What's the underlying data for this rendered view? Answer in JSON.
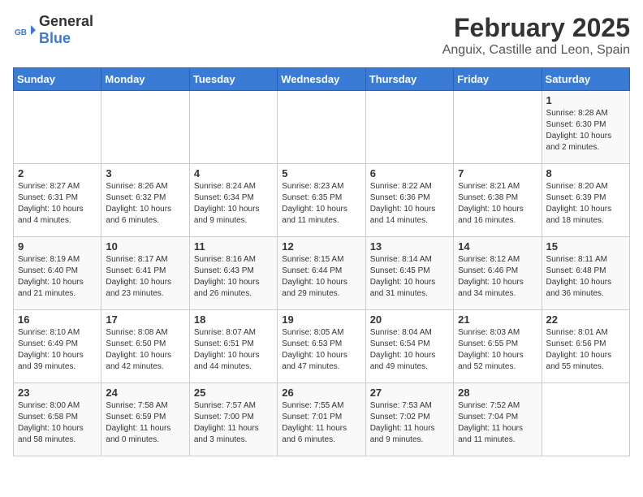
{
  "header": {
    "logo_general": "General",
    "logo_blue": "Blue",
    "main_title": "February 2025",
    "subtitle": "Anguix, Castille and Leon, Spain"
  },
  "weekdays": [
    "Sunday",
    "Monday",
    "Tuesday",
    "Wednesday",
    "Thursday",
    "Friday",
    "Saturday"
  ],
  "weeks": [
    [
      {
        "day": "",
        "info": ""
      },
      {
        "day": "",
        "info": ""
      },
      {
        "day": "",
        "info": ""
      },
      {
        "day": "",
        "info": ""
      },
      {
        "day": "",
        "info": ""
      },
      {
        "day": "",
        "info": ""
      },
      {
        "day": "1",
        "info": "Sunrise: 8:28 AM\nSunset: 6:30 PM\nDaylight: 10 hours and 2 minutes."
      }
    ],
    [
      {
        "day": "2",
        "info": "Sunrise: 8:27 AM\nSunset: 6:31 PM\nDaylight: 10 hours and 4 minutes."
      },
      {
        "day": "3",
        "info": "Sunrise: 8:26 AM\nSunset: 6:32 PM\nDaylight: 10 hours and 6 minutes."
      },
      {
        "day": "4",
        "info": "Sunrise: 8:24 AM\nSunset: 6:34 PM\nDaylight: 10 hours and 9 minutes."
      },
      {
        "day": "5",
        "info": "Sunrise: 8:23 AM\nSunset: 6:35 PM\nDaylight: 10 hours and 11 minutes."
      },
      {
        "day": "6",
        "info": "Sunrise: 8:22 AM\nSunset: 6:36 PM\nDaylight: 10 hours and 14 minutes."
      },
      {
        "day": "7",
        "info": "Sunrise: 8:21 AM\nSunset: 6:38 PM\nDaylight: 10 hours and 16 minutes."
      },
      {
        "day": "8",
        "info": "Sunrise: 8:20 AM\nSunset: 6:39 PM\nDaylight: 10 hours and 18 minutes."
      }
    ],
    [
      {
        "day": "9",
        "info": "Sunrise: 8:19 AM\nSunset: 6:40 PM\nDaylight: 10 hours and 21 minutes."
      },
      {
        "day": "10",
        "info": "Sunrise: 8:17 AM\nSunset: 6:41 PM\nDaylight: 10 hours and 23 minutes."
      },
      {
        "day": "11",
        "info": "Sunrise: 8:16 AM\nSunset: 6:43 PM\nDaylight: 10 hours and 26 minutes."
      },
      {
        "day": "12",
        "info": "Sunrise: 8:15 AM\nSunset: 6:44 PM\nDaylight: 10 hours and 29 minutes."
      },
      {
        "day": "13",
        "info": "Sunrise: 8:14 AM\nSunset: 6:45 PM\nDaylight: 10 hours and 31 minutes."
      },
      {
        "day": "14",
        "info": "Sunrise: 8:12 AM\nSunset: 6:46 PM\nDaylight: 10 hours and 34 minutes."
      },
      {
        "day": "15",
        "info": "Sunrise: 8:11 AM\nSunset: 6:48 PM\nDaylight: 10 hours and 36 minutes."
      }
    ],
    [
      {
        "day": "16",
        "info": "Sunrise: 8:10 AM\nSunset: 6:49 PM\nDaylight: 10 hours and 39 minutes."
      },
      {
        "day": "17",
        "info": "Sunrise: 8:08 AM\nSunset: 6:50 PM\nDaylight: 10 hours and 42 minutes."
      },
      {
        "day": "18",
        "info": "Sunrise: 8:07 AM\nSunset: 6:51 PM\nDaylight: 10 hours and 44 minutes."
      },
      {
        "day": "19",
        "info": "Sunrise: 8:05 AM\nSunset: 6:53 PM\nDaylight: 10 hours and 47 minutes."
      },
      {
        "day": "20",
        "info": "Sunrise: 8:04 AM\nSunset: 6:54 PM\nDaylight: 10 hours and 49 minutes."
      },
      {
        "day": "21",
        "info": "Sunrise: 8:03 AM\nSunset: 6:55 PM\nDaylight: 10 hours and 52 minutes."
      },
      {
        "day": "22",
        "info": "Sunrise: 8:01 AM\nSunset: 6:56 PM\nDaylight: 10 hours and 55 minutes."
      }
    ],
    [
      {
        "day": "23",
        "info": "Sunrise: 8:00 AM\nSunset: 6:58 PM\nDaylight: 10 hours and 58 minutes."
      },
      {
        "day": "24",
        "info": "Sunrise: 7:58 AM\nSunset: 6:59 PM\nDaylight: 11 hours and 0 minutes."
      },
      {
        "day": "25",
        "info": "Sunrise: 7:57 AM\nSunset: 7:00 PM\nDaylight: 11 hours and 3 minutes."
      },
      {
        "day": "26",
        "info": "Sunrise: 7:55 AM\nSunset: 7:01 PM\nDaylight: 11 hours and 6 minutes."
      },
      {
        "day": "27",
        "info": "Sunrise: 7:53 AM\nSunset: 7:02 PM\nDaylight: 11 hours and 9 minutes."
      },
      {
        "day": "28",
        "info": "Sunrise: 7:52 AM\nSunset: 7:04 PM\nDaylight: 11 hours and 11 minutes."
      },
      {
        "day": "",
        "info": ""
      }
    ]
  ]
}
